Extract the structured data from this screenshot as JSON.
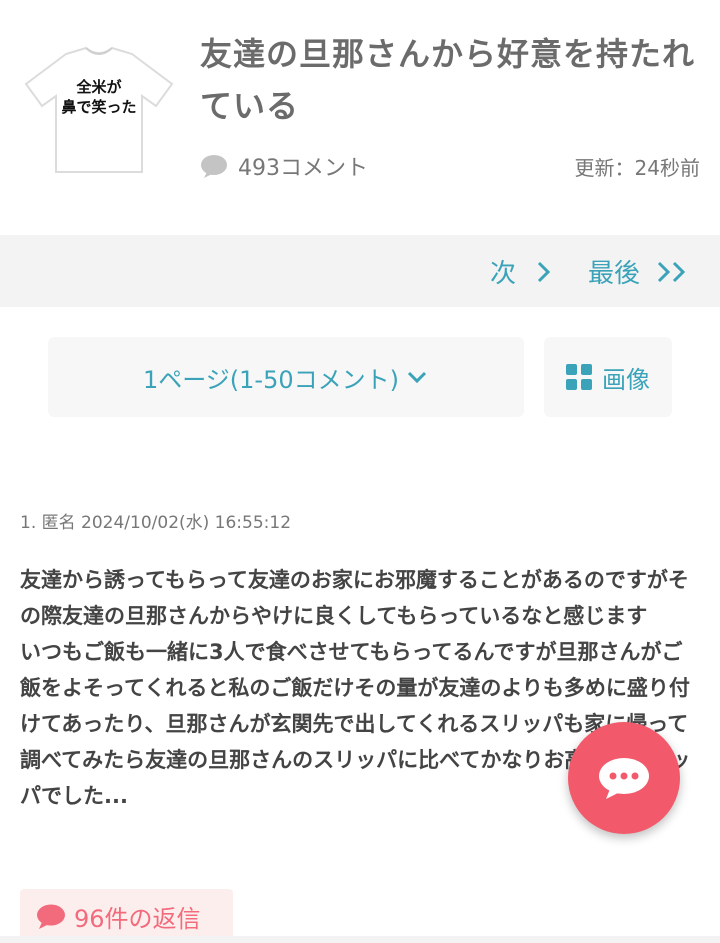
{
  "thread": {
    "thumb_text_line1": "全米が",
    "thumb_text_line2": "鼻で笑った",
    "title": "友達の旦那さんから好意を持たれている",
    "comment_count": "493コメント",
    "updated": "更新：24秒前"
  },
  "pager": {
    "next_label": "次",
    "last_label": "最後"
  },
  "controls": {
    "page_select_label": "1ページ(1-50コメント)",
    "image_label": "画像"
  },
  "comment": {
    "meta": "1. 匿名 2024/10/02(水) 16:55:12",
    "body": "友達から誘ってもらって友達のお家にお邪魔することがあるのですがその際友達の旦那さんからやけに良くしてもらっているなと感じます\nいつもご飯も一緒に3人で食べさせてもらってるんですが旦那さんがご飯をよそってくれると私のご飯だけその量が友達のよりも多めに盛り付けてあったり、旦那さんが玄関先で出してくれるスリッパも家に帰って調べてみたら友達の旦那さんのスリッパに比べてかなりお高めのスリッパでした...",
    "replies_label": "96件の返信"
  },
  "colors": {
    "accent": "#3aa3b9",
    "fab": "#f25a6b",
    "reply_text": "#f26b7c"
  }
}
